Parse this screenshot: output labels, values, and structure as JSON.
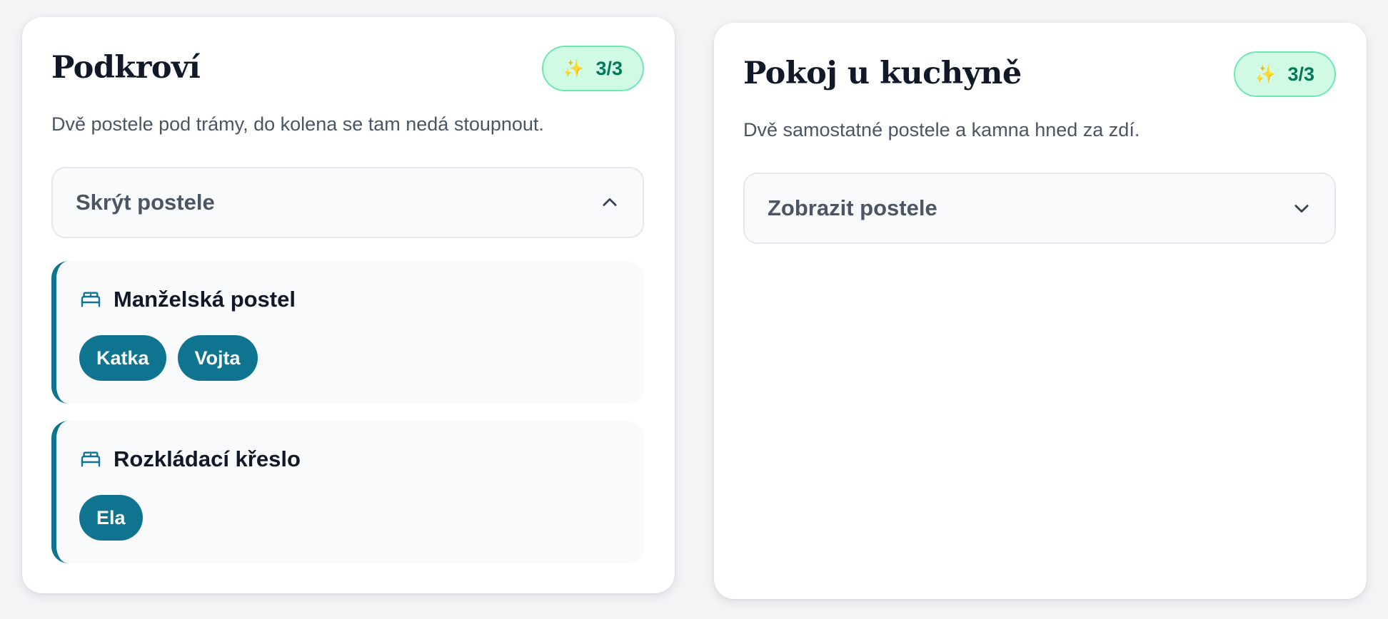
{
  "colors": {
    "accent": "#0e7490",
    "badge_bg": "#d1fae5",
    "badge_border": "#6ee7b7",
    "badge_text": "#047857",
    "card_bg": "#ffffff",
    "page_bg": "#f3f4f6"
  },
  "rooms": [
    {
      "title": "Podkroví",
      "badge": {
        "icon": "sparkles-icon",
        "glyph": "✨",
        "count": "3/3"
      },
      "description": "Dvě postele pod trámy, do kolena se tam nedá stoupnout.",
      "toggle": {
        "label": "Skrýt postele",
        "state": "expanded",
        "icon": "chevron-up-icon"
      },
      "beds": [
        {
          "name": "Manželská postel",
          "icon": "bed-icon",
          "occupants": [
            "Katka",
            "Vojta"
          ]
        },
        {
          "name": "Rozkládací křeslo",
          "icon": "bed-icon",
          "occupants": [
            "Ela"
          ]
        }
      ]
    },
    {
      "title": "Pokoj u kuchyně",
      "badge": {
        "icon": "sparkles-icon",
        "glyph": "✨",
        "count": "3/3"
      },
      "description": "Dvě samostatné postele a kamna hned za zdí.",
      "toggle": {
        "label": "Zobrazit postele",
        "state": "collapsed",
        "icon": "chevron-down-icon"
      },
      "beds": []
    }
  ]
}
